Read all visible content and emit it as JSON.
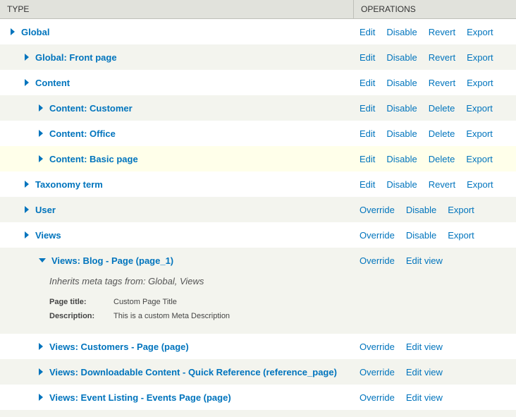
{
  "headers": {
    "type": "TYPE",
    "operations": "OPERATIONS"
  },
  "rows": [
    {
      "label": "Global",
      "ops": [
        "Edit",
        "Disable",
        "Revert",
        "Export"
      ]
    },
    {
      "label": "Global: Front page",
      "ops": [
        "Edit",
        "Disable",
        "Revert",
        "Export"
      ]
    },
    {
      "label": "Content",
      "ops": [
        "Edit",
        "Disable",
        "Revert",
        "Export"
      ]
    },
    {
      "label": "Content: Customer",
      "ops": [
        "Edit",
        "Disable",
        "Delete",
        "Export"
      ]
    },
    {
      "label": "Content: Office",
      "ops": [
        "Edit",
        "Disable",
        "Delete",
        "Export"
      ]
    },
    {
      "label": "Content: Basic page",
      "ops": [
        "Edit",
        "Disable",
        "Delete",
        "Export"
      ]
    },
    {
      "label": "Taxonomy term",
      "ops": [
        "Edit",
        "Disable",
        "Revert",
        "Export"
      ]
    },
    {
      "label": "User",
      "ops": [
        "Override",
        "Disable",
        "Export"
      ]
    },
    {
      "label": "Views",
      "ops": [
        "Override",
        "Disable",
        "Export"
      ]
    }
  ],
  "expanded": {
    "label": "Views: Blog - Page (page_1)",
    "ops": [
      "Override",
      "Edit view"
    ],
    "inherits": "Inherits meta tags from: Global, Views",
    "page_title_label": "Page title:",
    "page_title_value": "Custom Page Title",
    "description_label": "Description:",
    "description_value": "This is a custom Meta Description"
  },
  "rows_after": [
    {
      "label": "Views: Customers - Page (page)",
      "ops": [
        "Override",
        "Edit view"
      ]
    },
    {
      "label": "Views: Downloadable Content - Quick Reference (reference_page)",
      "ops": [
        "Override",
        "Edit view"
      ]
    },
    {
      "label": "Views: Event Listing - Events Page (page)",
      "ops": [
        "Override",
        "Edit view"
      ]
    }
  ]
}
